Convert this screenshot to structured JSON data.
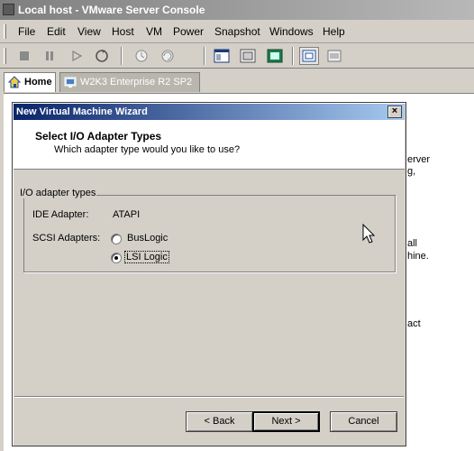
{
  "window": {
    "title": "Local host - VMware Server Console"
  },
  "menubar": {
    "items": [
      "File",
      "Edit",
      "View",
      "Host",
      "VM",
      "Power",
      "Snapshot",
      "Windows",
      "Help"
    ]
  },
  "toolbar": {
    "buttons": [
      "stop-icon",
      "pause-icon",
      "play-icon",
      "reset-icon",
      "snapshot-icon",
      "revert-icon",
      "show-sidebar-icon",
      "quick-switch-icon",
      "full-screen-icon",
      "summary-view-icon",
      "console-view-icon"
    ]
  },
  "tabs": {
    "home": "Home",
    "vm": "W2K3 Enterprise R2 SP2"
  },
  "background_text": [
    "erver",
    "g,",
    "all",
    "hine.",
    "act"
  ],
  "dialog": {
    "title": "New Virtual Machine Wizard",
    "close": "×",
    "header_title": "Select I/O Adapter Types",
    "header_subtitle": "Which adapter type would you like to use?",
    "group_title": "I/O adapter types",
    "ide_label": "IDE Adapter:",
    "ide_value": "ATAPI",
    "scsi_label": "SCSI Adapters:",
    "scsi_options": [
      {
        "label": "BusLogic",
        "selected": false
      },
      {
        "label": "LSI Logic",
        "selected": true
      }
    ],
    "back_label": "< Back",
    "next_label": "Next >",
    "cancel_label": "Cancel"
  }
}
